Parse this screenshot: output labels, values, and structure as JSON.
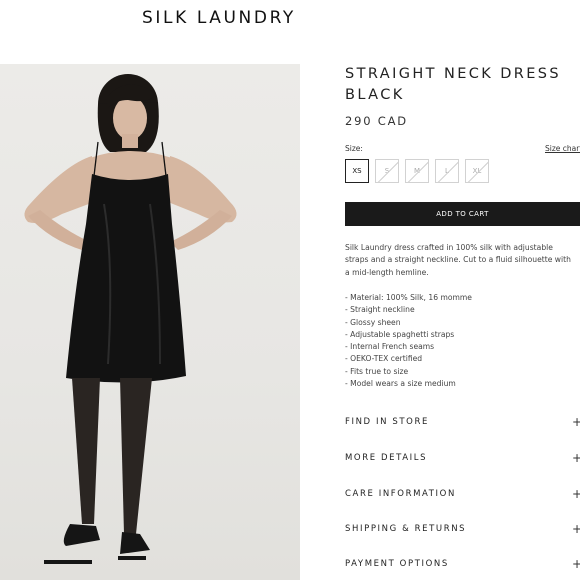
{
  "header": {
    "brand": "SILK LAUNDRY"
  },
  "product": {
    "title_line1": "STRAIGHT NECK DRESS",
    "title_line2": "BLACK",
    "price": "290 CAD",
    "size_label": "Size:",
    "size_chart_label": "Size chart",
    "sizes": [
      {
        "label": "XS",
        "available": true,
        "selected": true
      },
      {
        "label": "S",
        "available": false
      },
      {
        "label": "M",
        "available": false
      },
      {
        "label": "L",
        "available": false
      },
      {
        "label": "XL",
        "available": false
      }
    ],
    "add_to_cart_label": "ADD TO CART",
    "description": "Silk Laundry dress crafted in 100% silk with adjustable straps and a straight neckline. Cut to a fluid silhouette with a mid-length hemline.",
    "features": [
      "- Material: 100% Silk, 16 momme",
      "- Straight neckline",
      "- Glossy sheen",
      "- Adjustable spaghetti straps",
      "- Internal French seams",
      "- OEKO-TEX certified",
      "- Fits true to size",
      "- Model wears a size medium"
    ]
  },
  "accordion": [
    {
      "label": "FIND IN STORE",
      "icon": "+"
    },
    {
      "label": "MORE DETAILS",
      "icon": "+"
    },
    {
      "label": "CARE INFORMATION",
      "icon": "+"
    },
    {
      "label": "SHIPPING & RETURNS",
      "icon": "+"
    },
    {
      "label": "PAYMENT OPTIONS",
      "icon": "+"
    }
  ],
  "image": {
    "icon": "product-photo",
    "background": "#e9e8e5"
  }
}
